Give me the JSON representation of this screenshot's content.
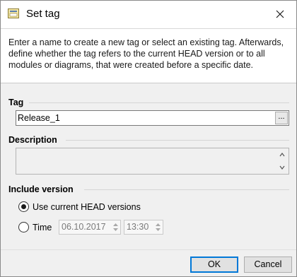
{
  "window": {
    "title": "Set tag",
    "app_icon": "tag-window-icon",
    "close_icon": "close-icon"
  },
  "info": {
    "text": "Enter a name to create a new tag or select an existing tag. Afterwards, define whether the tag refers to the current HEAD version or to all modules or diagrams, that were created before a specific date."
  },
  "tag": {
    "label": "Tag",
    "value": "Release_1",
    "browse_label": "..."
  },
  "description": {
    "label": "Description",
    "value": ""
  },
  "include_version": {
    "label": "Include version",
    "option_head": "Use current HEAD versions",
    "option_time": "Time",
    "selected": "head",
    "date": "06.10.2017",
    "time": "13:30"
  },
  "buttons": {
    "ok": "OK",
    "cancel": "Cancel"
  },
  "colors": {
    "accent": "#0078d7",
    "panel_bg": "#f0f0f0",
    "content_bg": "#ffffff"
  }
}
